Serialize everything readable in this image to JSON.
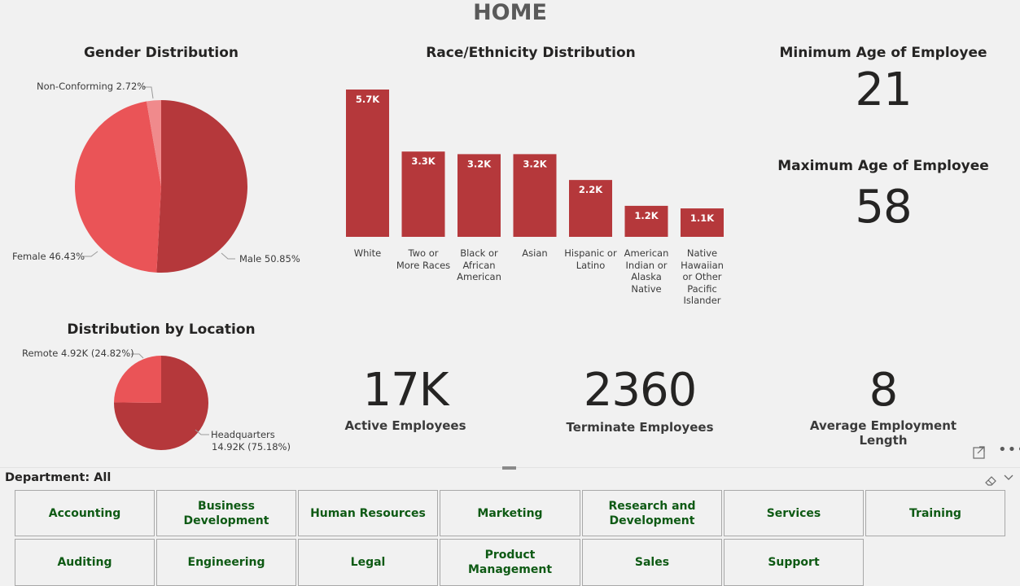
{
  "page": {
    "title": "HOME"
  },
  "gender": {
    "title": "Gender Distribution",
    "slices": [
      {
        "label": "Male 50.85%",
        "percent": 50.85,
        "color": "#b5383b"
      },
      {
        "label": "Female 46.43%",
        "percent": 46.43,
        "color": "#ea5457"
      },
      {
        "label": "Non-Conforming 2.72%",
        "percent": 2.72,
        "color": "#f08a8c"
      }
    ]
  },
  "race": {
    "title": "Race/Ethnicity Distribution",
    "bar_color": "#b5383b"
  },
  "chart_data": {
    "type": "bar",
    "title": "Race/Ethnicity Distribution",
    "categories": [
      "White",
      "Two or More Races",
      "Black or African American",
      "Asian",
      "Hispanic or Latino",
      "American Indian or Alaska Native",
      "Native Hawaiian or Other Pacific Islander"
    ],
    "category_lines": [
      [
        "White"
      ],
      [
        "Two or",
        "More Races"
      ],
      [
        "Black or",
        "African",
        "American"
      ],
      [
        "Asian"
      ],
      [
        "Hispanic or",
        "Latino"
      ],
      [
        "American",
        "Indian or",
        "Alaska",
        "Native"
      ],
      [
        "Native",
        "Hawaiian",
        "or Other",
        "Pacific",
        "Islander"
      ]
    ],
    "values": [
      5700,
      3300,
      3200,
      3200,
      2200,
      1200,
      1100
    ],
    "data_labels": [
      "5.7K",
      "3.3K",
      "3.2K",
      "3.2K",
      "2.2K",
      "1.2K",
      "1.1K"
    ],
    "ylim": [
      0,
      5700
    ]
  },
  "location": {
    "title": "Distribution by Location",
    "slices": [
      {
        "label": "Headquarters",
        "label2": "14.92K (75.18%)",
        "percent": 75.18,
        "color": "#b5383b"
      },
      {
        "label": "Remote 4.92K (24.82%)",
        "percent": 24.82,
        "color": "#ea5457"
      }
    ]
  },
  "kpis": {
    "min_age": {
      "label": "Minimum Age of Employee",
      "value": "21"
    },
    "max_age": {
      "label": "Maximum Age of Employee",
      "value": "58"
    },
    "active": {
      "label": "Active Employees",
      "value": "17K"
    },
    "terminated": {
      "label": "Terminate Employees",
      "value": "2360"
    },
    "avg_length": {
      "label_line1": "Average Employment",
      "label_line2": "Length",
      "value": "8"
    }
  },
  "slicer": {
    "header": "Department: All",
    "buttons": [
      "Accounting",
      "Business Development",
      "Human Resources",
      "Marketing",
      "Research and Development",
      "Services",
      "Training",
      "Auditing",
      "Engineering",
      "Legal",
      "Product Management",
      "Sales",
      "Support"
    ]
  },
  "icons": {
    "focus": "focus-mode-icon",
    "more": "more-options-icon",
    "eraser": "eraser-icon",
    "chevron": "chevron-down-icon"
  }
}
